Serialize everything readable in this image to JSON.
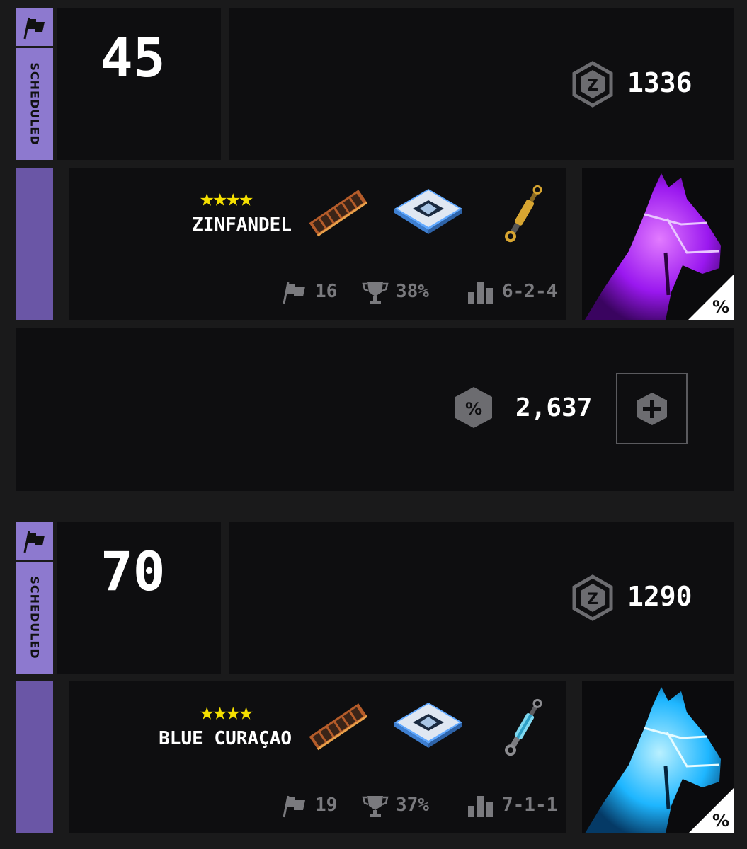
{
  "entries": [
    {
      "status": "SCHEDULED",
      "number": "45",
      "rating": "1336",
      "horse_name": "ZINFANDEL",
      "stars": "★★★★",
      "star_count": 4,
      "stats": {
        "races": "16",
        "win_rate": "38%",
        "record": "6-2-4"
      },
      "horse_color": "#a21fff",
      "equipment": [
        "circuit-board-icon",
        "chip-icon",
        "cylinder-icon"
      ]
    },
    {
      "status": "SCHEDULED",
      "number": "70",
      "rating": "1290",
      "horse_name": "BLUE CURAÇAO",
      "stars": "★★★★",
      "star_count": 4,
      "stats": {
        "races": "19",
        "win_rate": "37%",
        "record": "7-1-1"
      },
      "horse_color": "#1eb6ff",
      "equipment": [
        "circuit-board-icon",
        "chip-icon",
        "cylinder-icon"
      ]
    }
  ],
  "entry_fee": {
    "amount": "2,637",
    "currency_icon": "percent-hex-icon",
    "button_icon": "plus-hex-icon"
  },
  "colors": {
    "accent": "#8d79cf",
    "accent_dark": "#6a56a6",
    "panel": "#0e0e10",
    "star": "#f5e000",
    "muted": "#7a7a7e"
  }
}
